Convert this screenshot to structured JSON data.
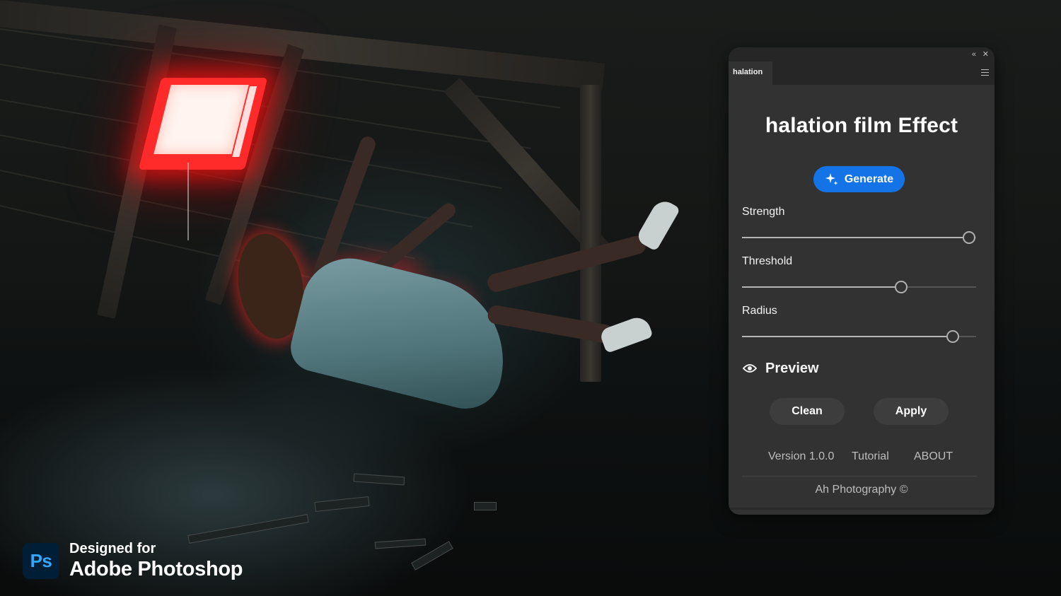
{
  "panel": {
    "tab_label": "halation",
    "title": "halation film Effect",
    "generate_label": "Generate",
    "sliders": [
      {
        "label": "Strength",
        "value_fraction": 0.97
      },
      {
        "label": "Threshold",
        "value_fraction": 0.68
      },
      {
        "label": "Radius",
        "value_fraction": 0.9
      }
    ],
    "preview_label": "Preview",
    "clean_label": "Clean",
    "apply_label": "Apply",
    "footer": {
      "version": "Version 1.0.0",
      "tutorial": "Tutorial",
      "about": "ABOUT",
      "copyright": "Ah Photography ©"
    }
  },
  "badge": {
    "logo_letters": "Ps",
    "line1": "Designed for",
    "line2": "Adobe Photoshop"
  },
  "colors": {
    "accent": "#1473e6",
    "panel_bg": "#323232",
    "ps_logo_bg": "#001e36",
    "ps_logo_fg": "#31a8ff",
    "halation_red": "#ff2a2a"
  },
  "icons": [
    "collapse-icon",
    "close-icon",
    "panel-menu-icon",
    "sparkle-icon",
    "eye-icon"
  ]
}
